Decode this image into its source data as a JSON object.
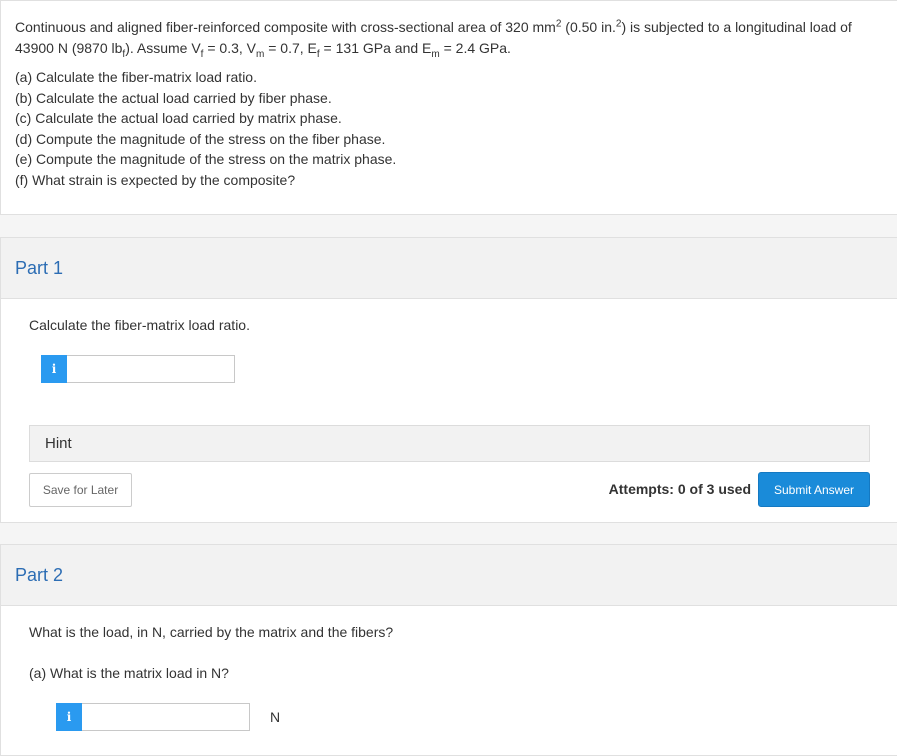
{
  "question": {
    "intro_1": "Continuous and aligned fiber-reinforced composite with cross-sectional area of 320 mm",
    "intro_sup1": "2",
    "intro_2": " (0.50 in.",
    "intro_sup2": "2",
    "intro_3": ") is subjected to a longitudinal load of 43900 N (9870 lb",
    "intro_sub_f": "f",
    "intro_4": "). Assume V",
    "intro_sub_f2": "f",
    "intro_5": " = 0.3, V",
    "intro_sub_m": "m",
    "intro_6": " = 0.7, E",
    "intro_sub_f3": "f",
    "intro_7": " = 131 GPa and E",
    "intro_sub_m2": "m",
    "intro_8": " = 2.4 GPa.",
    "items": [
      "(a) Calculate the fiber-matrix load ratio.",
      "(b) Calculate the actual load carried by fiber phase.",
      "(c) Calculate the actual load carried by matrix phase.",
      "(d) Compute the magnitude of the stress on the fiber phase.",
      "(e) Compute the magnitude of the stress on the matrix phase.",
      "(f) What strain is expected by the composite?"
    ]
  },
  "part1": {
    "title": "Part 1",
    "prompt": "Calculate the fiber-matrix load ratio.",
    "info_glyph": "i",
    "input_value": "",
    "hint_label": "Hint",
    "save_label": "Save for Later",
    "attempts": "Attempts: 0 of 3 used",
    "submit_label": "Submit Answer"
  },
  "part2": {
    "title": "Part 2",
    "prompt": "What is the load, in N, carried by the matrix and the fibers?",
    "sub_prompt": "(a) What is the matrix load in N?",
    "info_glyph": "i",
    "input_value": "",
    "unit": "N"
  },
  "colors": {
    "accent": "#2a9af0",
    "part_title": "#2c6db4",
    "submit": "#1a8bd9"
  }
}
